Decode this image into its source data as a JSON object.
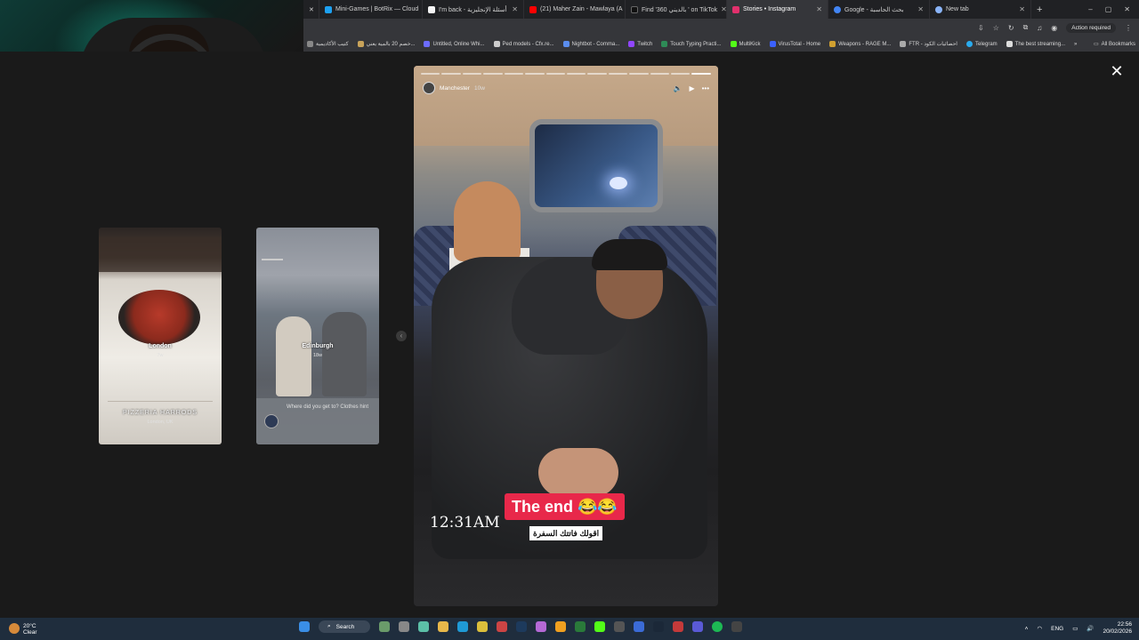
{
  "tabs": [
    {
      "label": "Mini-Games | BotRix — Cloud",
      "color": "#1da1f2",
      "active": false
    },
    {
      "label": "I'm back - أسئلة الإنجليزية",
      "color": "#f5f5f5",
      "active": false
    },
    {
      "label": "(21) Maher Zain - Mawlaya (A",
      "color": "#ff0000",
      "active": false
    },
    {
      "label": "Find '360 بالديني ' on TikTok",
      "color": "#111111",
      "active": false
    },
    {
      "label": "Stories • Instagram",
      "color": "#e1306c",
      "active": true
    },
    {
      "label": "Google - بحث الحاسبة",
      "color": "#4285f4",
      "active": false
    },
    {
      "label": "New tab",
      "color": "#8ab4f8",
      "active": false
    }
  ],
  "toolbar": {
    "action_label": "Action required"
  },
  "bookmarks": [
    {
      "label": "كتيب الأكاديمية",
      "color": "#888888"
    },
    {
      "label": "خصم 20 بالمية يعني...",
      "color": "#c8a35a"
    },
    {
      "label": "Untitled, Online Whi...",
      "color": "#6c6cff"
    },
    {
      "label": "Ped models - Cfx.re...",
      "color": "#cccccc"
    },
    {
      "label": "Nightbot - Comma...",
      "color": "#5a8dee"
    },
    {
      "label": "Twitch",
      "color": "#9146ff"
    },
    {
      "label": "Touch Typing Practi...",
      "color": "#2e8b57"
    },
    {
      "label": "MultiKick",
      "color": "#53fc18"
    },
    {
      "label": "VirusTotal - Home",
      "color": "#3b61ff"
    },
    {
      "label": "Weapons - RAGE M...",
      "color": "#d0a030"
    },
    {
      "label": "FTR - احصائيات الكود",
      "color": "#aaaaaa"
    },
    {
      "label": "Telegram",
      "color": "#2aabee"
    },
    {
      "label": "The best streaming...",
      "color": "#dddddd"
    }
  ],
  "bookmarks_all": "All Bookmarks",
  "previews": {
    "london": {
      "label": "London",
      "age": "7w",
      "sign": "PIZZERIA HARRODS",
      "sign_sub": "London, UK"
    },
    "edinburgh": {
      "label": "Edinburgh",
      "age": "18w",
      "prompt": "Where did you get to? Clothes hint"
    }
  },
  "story": {
    "username": "Manchester",
    "age": "10w",
    "caption": "The end 😂😂",
    "caption_ar": "اقولك فاتتك السفرة",
    "timestamp": "12:31AM",
    "segments": 14,
    "current_segment": 13
  },
  "taskbar": {
    "temp": "20°C",
    "condition": "Clear",
    "search": "Search",
    "lang": "ENG",
    "time": "22:56",
    "date": "20/02/2026"
  }
}
